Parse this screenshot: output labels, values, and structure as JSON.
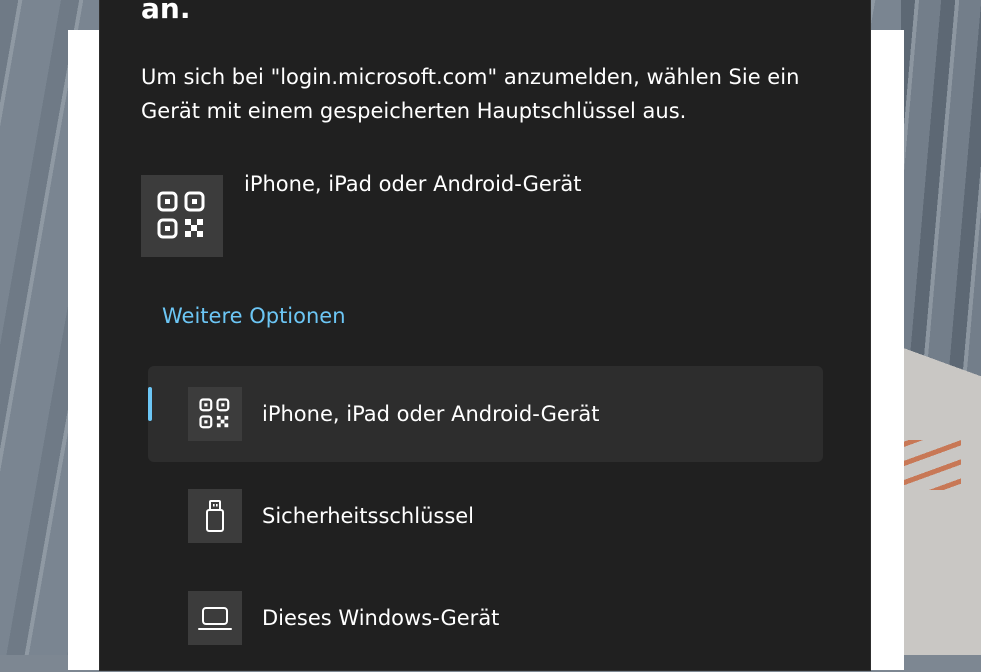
{
  "dialog": {
    "title_fragment": "an.",
    "description": "Um sich bei \"login.microsoft.com\" anzumelden, wählen Sie ein Gerät mit einem gespeicherten Hauptschlüssel aus.",
    "primary_option": {
      "label": "iPhone, iPad oder Android-Gerät",
      "icon": "qr-code-icon"
    },
    "more_options_label": "Weitere Optionen",
    "options": [
      {
        "label": "iPhone, iPad oder Android-Gerät",
        "icon": "qr-code-icon",
        "selected": true
      },
      {
        "label": "Sicherheitsschlüssel",
        "icon": "usb-key-icon",
        "selected": false
      },
      {
        "label": "Dieses Windows-Gerät",
        "icon": "laptop-icon",
        "selected": false
      }
    ]
  },
  "colors": {
    "dialog_bg": "#202020",
    "tile_bg": "#3c3c3c",
    "selected_bg": "#2d2d2d",
    "accent": "#6cc6f5"
  }
}
